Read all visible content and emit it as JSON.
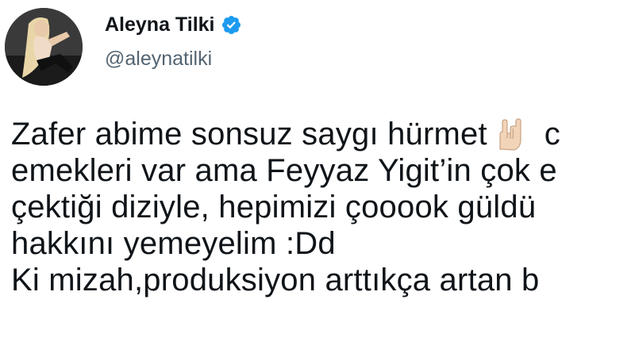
{
  "tweet": {
    "author": {
      "display_name": "Aleyna Tilki",
      "handle": "@aleynatilki",
      "verified": true,
      "verified_color": "#1d9bf0",
      "avatar_icon": "profile-photo"
    },
    "lines": [
      "Zafer abime sonsuz saygı hürmet",
      "emekleri var ama Feyyaz Yigit’in çok e",
      "çektiği diziyle, hepimizi çooook güldü",
      "hakkını yemeyelim :Dd",
      "Ki mizah,produksiyon arttıkça artan b"
    ],
    "line1_trailing": "c",
    "emoji": "horns-hand-light-skin-tone"
  },
  "colors": {
    "text": "#0f1419",
    "secondary_text": "#536471",
    "background": "#ffffff"
  }
}
